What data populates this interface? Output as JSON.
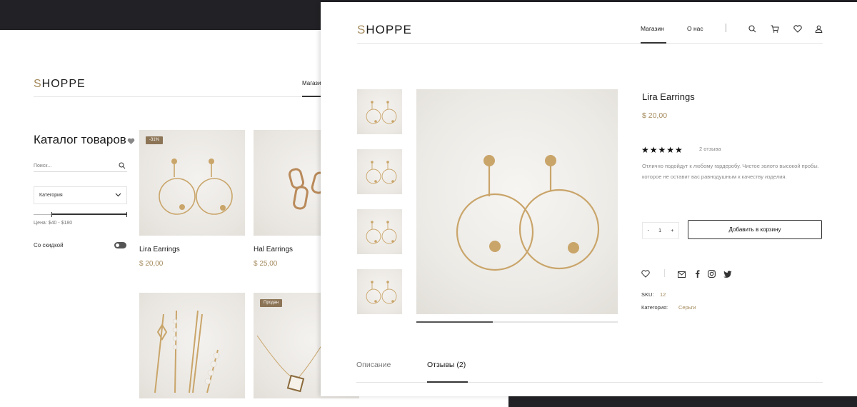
{
  "colors": {
    "accent": "#a48a5c",
    "badge": "#8c7456",
    "backdrop": "#222226"
  },
  "catalog": {
    "logo_first": "S",
    "logo_rest": "HOPPE",
    "nav_shop": "Магазин",
    "title": "Каталог товаров",
    "search_placeholder": "Поиск...",
    "category_label": "Категория",
    "price_range": "Цена: $40 - $180",
    "sale_label": "Со скидкой",
    "products": [
      {
        "name": "Lira Earrings",
        "price": "$ 20,00",
        "badge": "-31%",
        "icon": "earrings-hoop"
      },
      {
        "name": "Hal Earrings",
        "price": "$ 25,00",
        "icon": "earrings-link"
      },
      {
        "name": "",
        "price": "",
        "icon": "hair-pins"
      },
      {
        "name": "",
        "price": "",
        "badge": "Продан",
        "icon": "necklace"
      }
    ]
  },
  "product": {
    "logo_first": "S",
    "logo_rest": "HOPPE",
    "nav": {
      "shop": "Магазин",
      "about": "О нас"
    },
    "icons": [
      "search-icon",
      "cart-icon",
      "heart-icon",
      "user-icon"
    ],
    "title": "Lira Earrings",
    "price": "$ 20,00",
    "rating": 5,
    "stars": "★★★★★",
    "reviews": "2 отзыва",
    "description": "Отлично подойдут к любому гардеробу. Чистое золото высокой пробы. которое не оставит вас равнодушным к качеству изделия.",
    "qty": {
      "minus": "-",
      "value": "1",
      "plus": "+"
    },
    "add_to_cart": "Добавить в корзину",
    "sku_label": "SKU:",
    "sku_value": "12",
    "category_label": "Категория:",
    "category_value": "Серьги",
    "gallery_progress": 0.38,
    "tabs": [
      {
        "label": "Описание",
        "active": false
      },
      {
        "label": "Отзывы (2)",
        "active": true
      }
    ]
  }
}
